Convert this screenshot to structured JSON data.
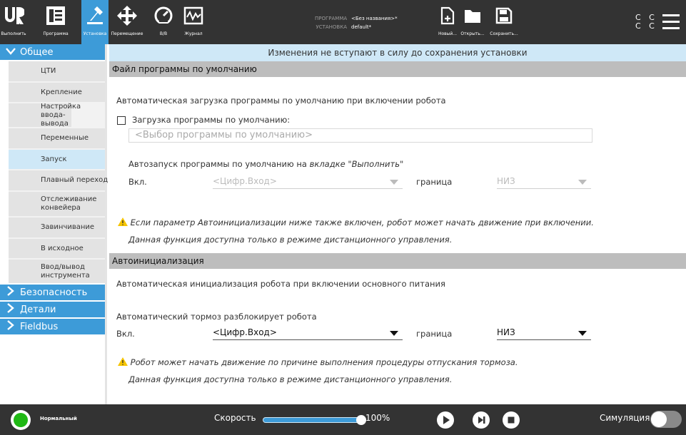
{
  "topbar": {
    "buttons": [
      {
        "label": "Выполнить",
        "icon": "ur-logo-icon"
      },
      {
        "label": "Программа",
        "icon": "program-icon"
      },
      {
        "label": "Установка",
        "icon": "installation-icon"
      },
      {
        "label": "Перемещение",
        "icon": "move-icon"
      },
      {
        "label": "В/В",
        "icon": "io-icon"
      },
      {
        "label": "Журнал",
        "icon": "log-icon"
      }
    ],
    "program_label": "ПРОГРАММА",
    "program_value": "<Без названия>*",
    "installation_label": "УСТАНОВКА",
    "installation_value": "default*",
    "file_buttons": [
      {
        "label": "Новый...",
        "icon": "new-file-icon"
      },
      {
        "label": "Открыть...",
        "icon": "open-folder-icon"
      },
      {
        "label": "Сохранить...",
        "icon": "save-icon"
      }
    ],
    "cc": [
      "C C",
      "C C"
    ]
  },
  "sidebar": {
    "groups": [
      {
        "label": "Общее",
        "expanded": true
      },
      {
        "label": "Безопасность",
        "expanded": false
      },
      {
        "label": "Детали",
        "expanded": false
      },
      {
        "label": "Fieldbus",
        "expanded": false
      }
    ],
    "items": [
      "ЦТИ",
      "Крепление",
      "Настройка ввода-вывода",
      "Переменные",
      "Запуск",
      "Плавный переход",
      "Отслеживание конвейера",
      "Завинчивание",
      "В исходное",
      "Ввод/вывод инструмента"
    ],
    "active_item": "Запуск"
  },
  "main": {
    "banner": "Изменения не вступают в силу до сохранения установки",
    "section1": {
      "title": "Файл программы по умолчанию",
      "desc": "Автоматическая загрузка программы по умолчанию при включении робота",
      "checkbox_label": "Загрузка программы по умолчанию:",
      "checkbox_checked": false,
      "program_placeholder": "<Выбор программы по умолчанию>",
      "autostart_prefix": "Автозапуск программы по умолчанию на ",
      "autostart_tab": "вкладке \"Выполнить\"",
      "autostart_suffix": "",
      "on_label": "Вкл.",
      "input_select": "<Цифр.Вход>",
      "edge_label": "граница",
      "edge_select": "НИЗ",
      "warning1": "Если параметр Автоинициализации ниже также включен, робот может начать движение при включении.",
      "warning2": "Данная функция доступна только в режиме дистанционного управления."
    },
    "section2": {
      "title": "Автоинициализация",
      "desc": "Автоматическая инициализация робота при включении основного питания",
      "brake_label": "Автоматический тормоз разблокирует робота",
      "on_label": "Вкл.",
      "input_select": "<Цифр.Вход>",
      "edge_label": "граница",
      "edge_select": "НИЗ",
      "warning1": "Робот может начать движение по причине выполнения процедуры отпускания тормоза.",
      "warning2": "Данная функция доступна только в режиме дистанционного управления."
    }
  },
  "bottombar": {
    "status": "Нормальный",
    "speed_label": "Скорость",
    "speed_value": "100%",
    "speed_fraction": 1.0,
    "simulation_label": "Симуляция",
    "simulation_on": false
  },
  "colors": {
    "topbar_bg": "#333333",
    "accent": "#3d9bd8",
    "banner_bg": "#cfe8f7",
    "section_header_bg": "#bdbdbd",
    "power_green": "#1fb814",
    "warning_yellow": "#f5c400"
  }
}
